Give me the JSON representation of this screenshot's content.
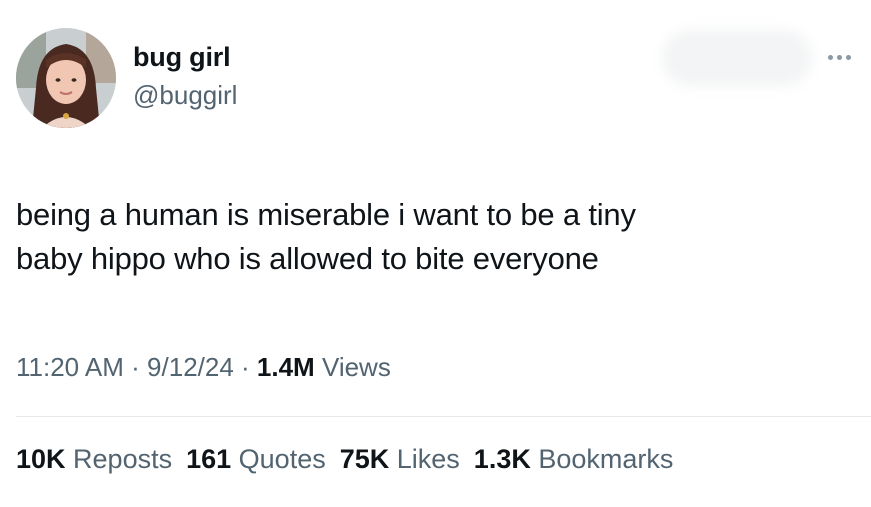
{
  "author": {
    "display_name": "bug girl",
    "handle": "@buggirl"
  },
  "tweet": {
    "lines": [
      "being a human is miserable i want to be a tiny",
      "baby hippo who is allowed to bite everyone"
    ]
  },
  "meta": {
    "time": "11:20 AM",
    "sep1": " · ",
    "date": "9/12/24",
    "sep2": " · ",
    "views_count": "1.4M",
    "views_label": " Views"
  },
  "stats": {
    "reposts": {
      "count": "10K",
      "label": " Reposts"
    },
    "quotes": {
      "count": "161",
      "label": " Quotes"
    },
    "likes": {
      "count": "75K",
      "label": " Likes"
    },
    "bookmarks": {
      "count": "1.3K",
      "label": " Bookmarks"
    }
  },
  "icons": {
    "more": "more-horizontal-icon"
  },
  "colors": {
    "primary_text": "#0f1419",
    "secondary_text": "#536471",
    "divider": "#e6e9ec"
  }
}
